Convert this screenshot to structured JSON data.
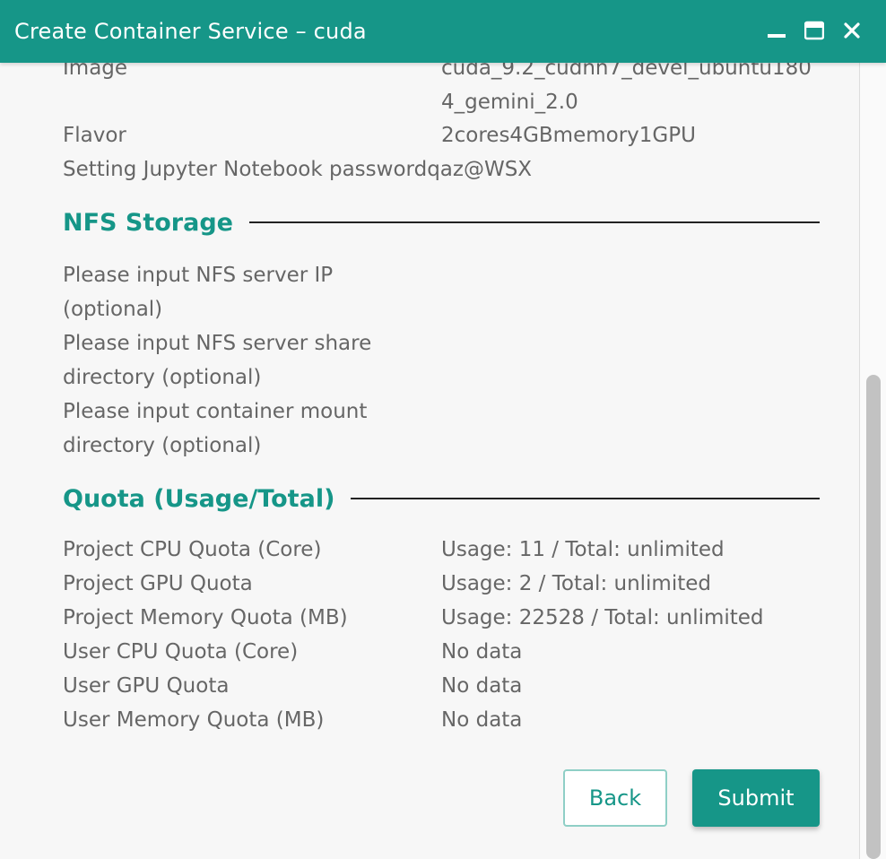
{
  "window": {
    "title": "Create Container Service – cuda",
    "controls": [
      "minimize-icon",
      "maximize-icon",
      "close-icon"
    ]
  },
  "summary": [
    {
      "label": "Image",
      "value_line1": "cuda_9.2_cudnn7_devel_ubuntu180",
      "value_line2": "4_gemini_2.0"
    },
    {
      "label": "Flavor",
      "value": "2cores4GBmemory1GPU"
    },
    {
      "label": "Setting Jupyter Notebook password",
      "value": "qaz@WSX"
    }
  ],
  "nfs": {
    "title": "NFS Storage",
    "fields": [
      {
        "line1": "Please input NFS server IP",
        "line2": "(optional)"
      },
      {
        "line1": "Please input NFS server share",
        "line2": "directory (optional)"
      },
      {
        "line1": "Please input container mount",
        "line2": "directory (optional)"
      }
    ]
  },
  "quota": {
    "title": "Quota (Usage/Total)",
    "rows": [
      {
        "label": "Project CPU Quota (Core)",
        "value": "Usage: 11 / Total: unlimited"
      },
      {
        "label": "Project GPU Quota",
        "value": "Usage: 2 / Total: unlimited"
      },
      {
        "label": "Project Memory Quota (MB)",
        "value": "Usage: 22528 / Total: unlimited"
      },
      {
        "label": "User CPU Quota (Core)",
        "value": "No data"
      },
      {
        "label": "User GPU Quota",
        "value": "No data"
      },
      {
        "label": "User Memory Quota (MB)",
        "value": "No data"
      }
    ]
  },
  "buttons": {
    "back": "Back",
    "submit": "Submit"
  },
  "colors": {
    "accent": "#169688",
    "text": "#666666",
    "background": "#f7f7f7"
  }
}
